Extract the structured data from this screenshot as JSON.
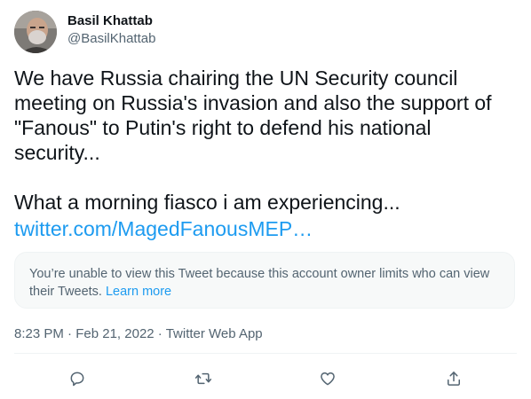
{
  "author": {
    "display_name": "Basil Khattab",
    "handle": "@BasilKhattab"
  },
  "tweet": {
    "text": "We have Russia chairing the UN Security council meeting on Russia's invasion and also the support of \"Fanous\" to Putin's right to defend his national security...\n\nWhat a morning fiasco i am experiencing...",
    "link": "twitter.com/MagedFanousMEP…"
  },
  "quoted_notice": {
    "text": "You’re unable to view this Tweet because this account owner limits who can view their Tweets.",
    "link_label": "Learn more"
  },
  "meta": {
    "time": "8:23 PM",
    "date": "Feb 21, 2022",
    "source": "Twitter Web App"
  },
  "icons": {
    "reply": "reply-icon",
    "retweet": "retweet-icon",
    "like": "like-icon",
    "share": "share-icon"
  },
  "colors": {
    "text": "#0f1419",
    "secondary": "#536471",
    "accent": "#1d9bf0"
  }
}
